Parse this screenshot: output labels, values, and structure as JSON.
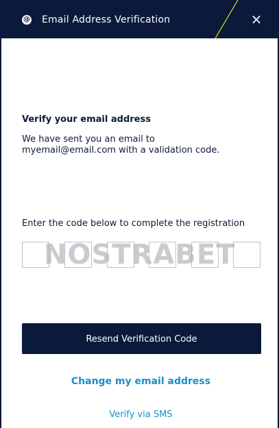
{
  "header": {
    "icon": "at-sign-icon",
    "icon_glyph": "@",
    "title": "Email Address Verification",
    "close_glyph": "×",
    "background_color": "#0b1a3a",
    "accent_color": "#e8e000"
  },
  "verify": {
    "heading": "Verify your email address",
    "message_line1": "We have sent you an email to",
    "message_line2": "myemail@email.com with a validation code."
  },
  "code": {
    "label": "Enter the code below to complete the registration",
    "boxes": [
      "",
      "",
      "",
      "",
      "",
      ""
    ]
  },
  "watermark": {
    "text": "NOSTRABET"
  },
  "actions": {
    "resend_label": "Resend Verification Code",
    "change_email_label": "Change my email address",
    "sms_label": "Verify via SMS"
  },
  "colors": {
    "primary": "#0b1a3a",
    "link": "#1a8fc8",
    "input_border": "#b9c2d6"
  }
}
